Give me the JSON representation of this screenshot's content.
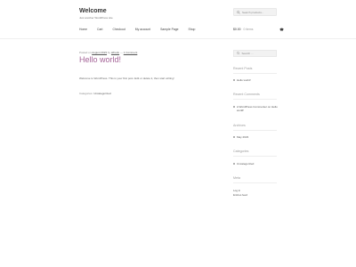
{
  "site": {
    "title": "Welcome",
    "description": "Just another WordPress site"
  },
  "header_search": {
    "placeholder": "Search products..."
  },
  "nav": [
    "Home",
    "Cart",
    "Checkout",
    "My account",
    "Sample Page",
    "Shop"
  ],
  "cart": {
    "amount": "$0.00",
    "count": "0 items"
  },
  "post": {
    "posted_prefix": "Posted on",
    "date": "August 2023",
    "by": "by",
    "author": "alfredo",
    "sep": "—",
    "comment_link": "1 Comment",
    "title": "Hello world!",
    "body": "Welcome to WordPress. This is your first post. Edit or delete it, then start writing!",
    "categories_prefix": "Categories:",
    "category": "Uncategorized"
  },
  "sidebar": {
    "search_placeholder": "Search …",
    "recent_posts": {
      "title": "Recent Posts",
      "items": [
        "Hello world!"
      ]
    },
    "recent_comments": {
      "title": "Recent Comments",
      "items": [
        "A WordPress Commenter on Hello world!"
      ]
    },
    "archives": {
      "title": "Archives",
      "items": [
        "May 2023"
      ]
    },
    "categories": {
      "title": "Categories",
      "items": [
        "Uncategorized"
      ]
    },
    "meta": {
      "title": "Meta",
      "items": [
        "Log in",
        "Entries feed"
      ]
    }
  },
  "colors": {
    "accent": "#a46497"
  }
}
